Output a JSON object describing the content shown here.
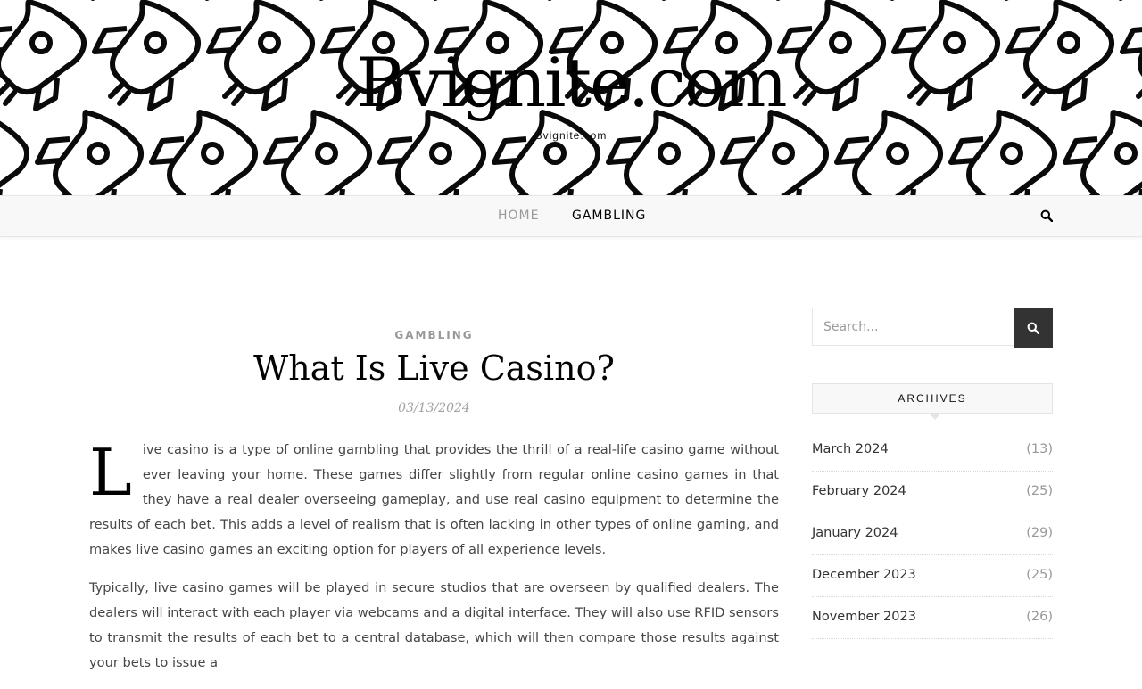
{
  "site": {
    "title": "Bvignite.com",
    "tagline": "Bvignite.com"
  },
  "nav": {
    "items": [
      {
        "label": "Home",
        "active": false
      },
      {
        "label": "Gambling",
        "active": true
      }
    ],
    "search_icon": "search-icon"
  },
  "post": {
    "category": "Gambling",
    "title": "What Is Live Casino?",
    "date": "03/13/2024",
    "dropcap": "L",
    "paragraph1": "ive casino is a type of online gambling that provides the thrill of a real-life casino game without ever leaving your home. These games differ slightly from regular online casino games in that they have a real dealer overseeing gameplay, and use real casino equipment to determine the results of each bet. This adds a level of realism that is often lacking in other types of online gaming, and makes live casino games an exciting option for players of all experience levels.",
    "paragraph2": "Typically, live casino games will be played in secure studios that are overseen by qualified dealers. The dealers will interact with each player via webcams and a digital interface. They will also use RFID sensors to transmit the results of each bet to a central database, which will then compare those results against your bets to issue a"
  },
  "sidebar": {
    "search_placeholder": "Search...",
    "archives_title": "Archives",
    "archives": [
      {
        "label": "March 2024",
        "count": "(13)"
      },
      {
        "label": "February 2024",
        "count": "(25)"
      },
      {
        "label": "January 2024",
        "count": "(29)"
      },
      {
        "label": "December 2023",
        "count": "(25)"
      },
      {
        "label": "November 2023",
        "count": "(26)"
      }
    ]
  },
  "colors": {
    "accent_dark": "#333333",
    "nav_active": "#000000",
    "nav_inactive": "#999999",
    "muted": "#999999"
  }
}
